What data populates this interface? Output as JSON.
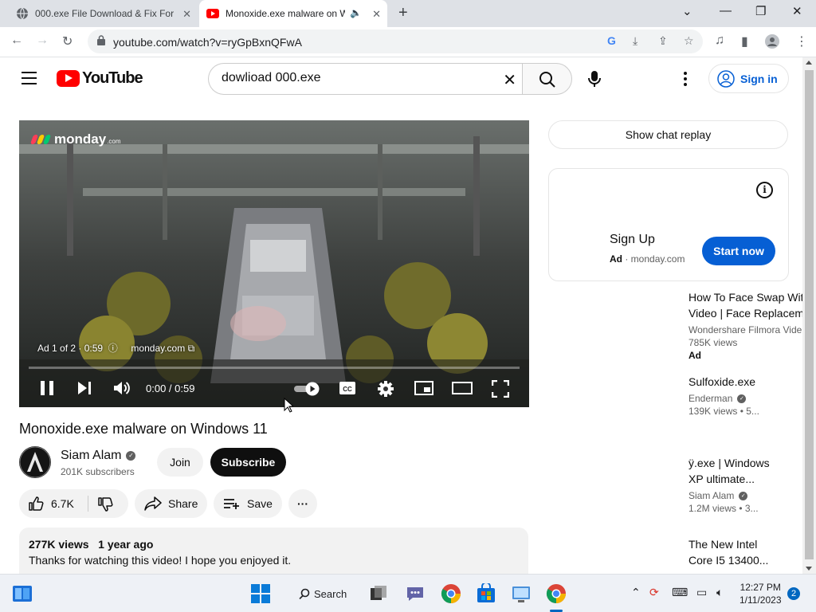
{
  "browser": {
    "tabs": [
      {
        "title": "000.exe File Download & Fix For"
      },
      {
        "title": "Monoxide.exe malware on Windows 11"
      }
    ],
    "url": "youtube.com/watch?v=ryGpBxnQFwA"
  },
  "header": {
    "logo_text": "YouTube",
    "search_query": "dowlioad 000.exe",
    "signin_label": "Sign in"
  },
  "player": {
    "brand": "monday",
    "brand_suffix": ".com",
    "ad_info": "Ad 1 of 2 · 0:59",
    "ad_domain": "monday.com",
    "time": "0:00 / 0:59",
    "progress_fraction": 0.0
  },
  "video": {
    "title": "Monoxide.exe malware on Windows 11",
    "channel": "Siam Alam",
    "subscribers": "201K subscribers",
    "join_label": "Join",
    "subscribe_label": "Subscribe",
    "likes": "6.7K",
    "share_label": "Share",
    "save_label": "Save",
    "views": "277K views",
    "age": "1 year ago",
    "description": "Thanks for watching this video! I hope you enjoyed it."
  },
  "sidebar": {
    "chat_replay": "Show chat replay",
    "ad": {
      "headline": "Sign Up",
      "ad_label": "Ad",
      "domain": "monday.com",
      "cta": "Start now"
    },
    "recommendations": [
      {
        "title1": "How To Face Swap Wit",
        "title2": "Video | Face Replacem",
        "channel": "Wondershare Filmora Vide",
        "views": "785K views",
        "badge": "Ad"
      },
      {
        "title1": "Sulfoxide.exe",
        "title2": "",
        "channel": "Enderman",
        "views": "139K views  • 5..."
      },
      {
        "title1": "ÿ.exe | Windows",
        "title2": "XP ultimate...",
        "channel": "Siam Alam",
        "views": "1.2M views  • 3..."
      },
      {
        "title1": "The New Intel",
        "title2": "Core I5 13400...",
        "channel": "",
        "views": ""
      }
    ]
  },
  "taskbar": {
    "search_label": "Search",
    "time": "12:27 PM",
    "date": "1/11/2023",
    "notifications": "2"
  },
  "colors": {
    "youtube_red": "#ff0000",
    "link_blue": "#065fd4",
    "progress_yellow": "#ffcc00"
  }
}
